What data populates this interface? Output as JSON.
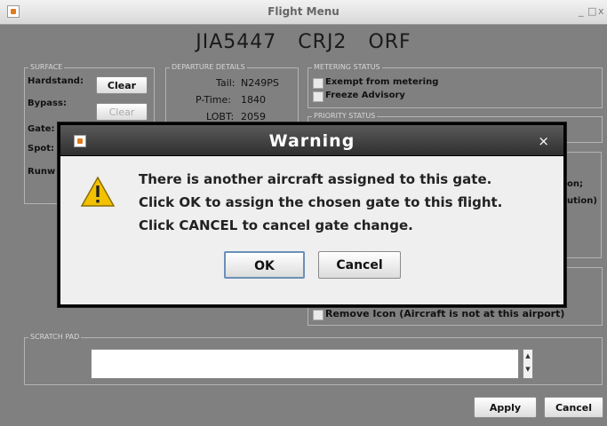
{
  "window": {
    "title": "Flight Menu",
    "controls": [
      "_",
      "□",
      "x"
    ]
  },
  "flight": {
    "callsign": "JIA5447",
    "aircraft": "CRJ2",
    "airport": "ORF"
  },
  "surface": {
    "legend": "SURFACE",
    "hardstand_label": "Hardstand:",
    "bypass_label": "Bypass:",
    "gate_label": "Gate:",
    "spot_label": "Spot:",
    "runway_label": "Runw",
    "clear_label": "Clear",
    "clear_disabled_label": "Clear"
  },
  "departure": {
    "legend": "DEPARTURE DETAILS",
    "tail_label": "Tail:",
    "tail_value": "N249PS",
    "ptime_label": "P-Time:",
    "ptime_value": "1840",
    "lobt_label": "LOBT:",
    "lobt_value": "2059"
  },
  "metering": {
    "legend": "METERING STATUS",
    "exempt_label": "Exempt from metering",
    "freeze_label": "Freeze Advisory"
  },
  "priority": {
    "legend": "PRIORITY STATUS"
  },
  "right_fragments": {
    "line1": "on;",
    "line2": "ution)"
  },
  "remove_icon_label": "Remove Icon (Aircraft is not at this airport)",
  "scratch": {
    "legend": "SCRATCH PAD",
    "value": ""
  },
  "footer": {
    "apply_label": "Apply",
    "cancel_label": "Cancel"
  },
  "dialog": {
    "title": "Warning",
    "close": "×",
    "line1": "There is another aircraft assigned to this gate.",
    "line2": "Click OK to assign the chosen gate to this flight.",
    "line3": "Click CANCEL to cancel gate change.",
    "ok_label": "OK",
    "cancel_label": "Cancel"
  },
  "colors": {
    "window_bg": "#7f7f7f",
    "dialog_title": "#3c3c3c",
    "warning_icon": "#f2c200"
  }
}
